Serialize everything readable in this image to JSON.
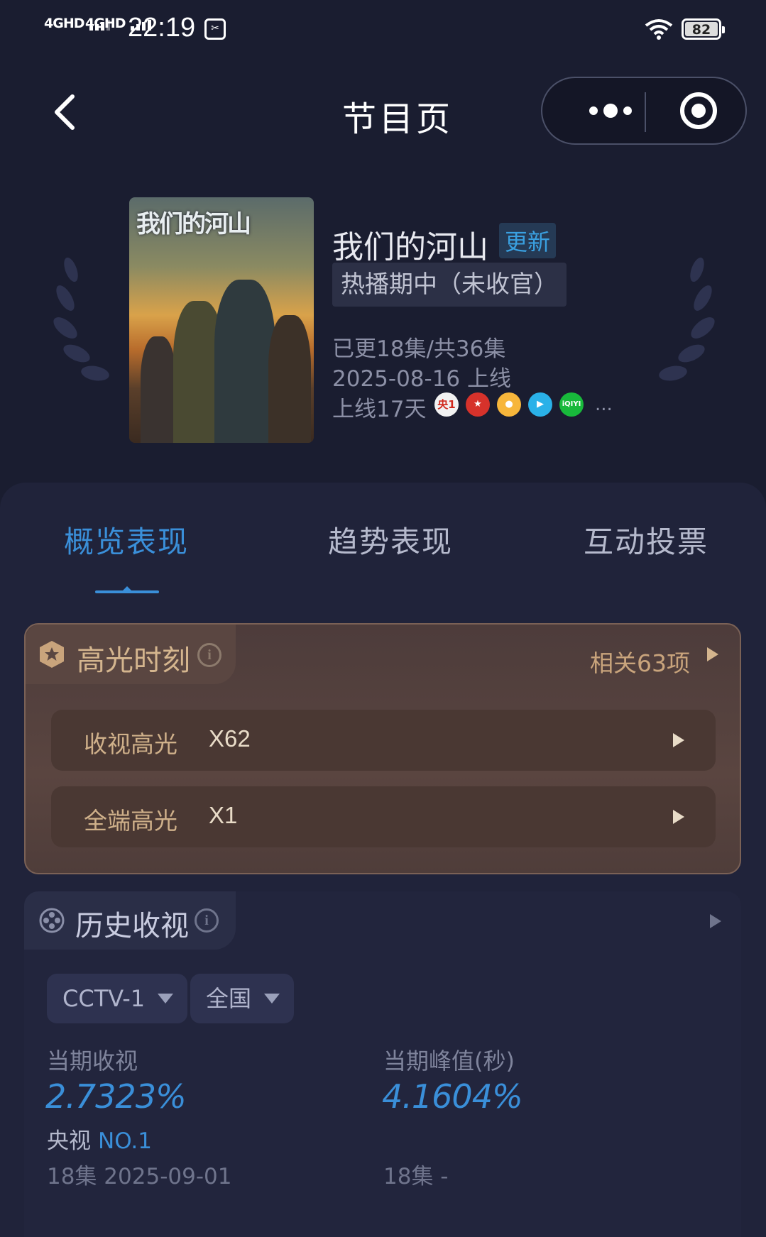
{
  "status_bar": {
    "signal1": "4GHD",
    "signal2": "4GHD",
    "time": "22:19",
    "battery": "82"
  },
  "nav": {
    "title": "节目页"
  },
  "show": {
    "poster_title": "我们的河山",
    "name": "我们的河山",
    "update_badge": "更新",
    "status": "热播期中（未收官）",
    "episodes": "已更18集/共36集",
    "premiere": "2025-08-16 上线",
    "days_online": "上线17天",
    "platforms": [
      {
        "name": "CCTV-1",
        "label": "央1",
        "icon": "cctv1-logo",
        "color": "#d0281c"
      },
      {
        "name": "Dragon TV",
        "label": "",
        "icon": "dragon-tv-logo",
        "color": "#d6322b"
      },
      {
        "name": "Mango TV",
        "label": "",
        "icon": "mango-tv-logo",
        "color": "#f7b63b"
      },
      {
        "name": "Tencent Video",
        "label": "",
        "icon": "tencent-video-logo",
        "color": "#2ab1e8"
      },
      {
        "name": "iQIYI",
        "label": "iQIYI",
        "icon": "iqiyi-logo",
        "color": "#18b93b"
      }
    ],
    "platforms_more": "..."
  },
  "tabs": [
    {
      "label": "概览表现",
      "active": true
    },
    {
      "label": "趋势表现",
      "active": false
    },
    {
      "label": "互动投票",
      "active": false
    }
  ],
  "highlights": {
    "title": "高光时刻",
    "related": "相关63项",
    "rows": [
      {
        "label": "收视高光",
        "value": "X62"
      },
      {
        "label": "全端高光",
        "value": "X1"
      }
    ]
  },
  "history": {
    "title": "历史收视",
    "channel": "CCTV-1",
    "region": "全国",
    "current_rating_label": "当期收视",
    "current_rating_value": "2.7323%",
    "rank_prefix": "央视",
    "rank_value": "NO.1",
    "current_rating_foot": "18集 2025-09-01",
    "peak_label": "当期峰值(秒)",
    "peak_value": "4.1604%",
    "peak_foot": "18集 -"
  },
  "colors": {
    "accent": "#3a8fd9",
    "background": "#1a1d30",
    "highlight_gold": "#d4b58e"
  }
}
